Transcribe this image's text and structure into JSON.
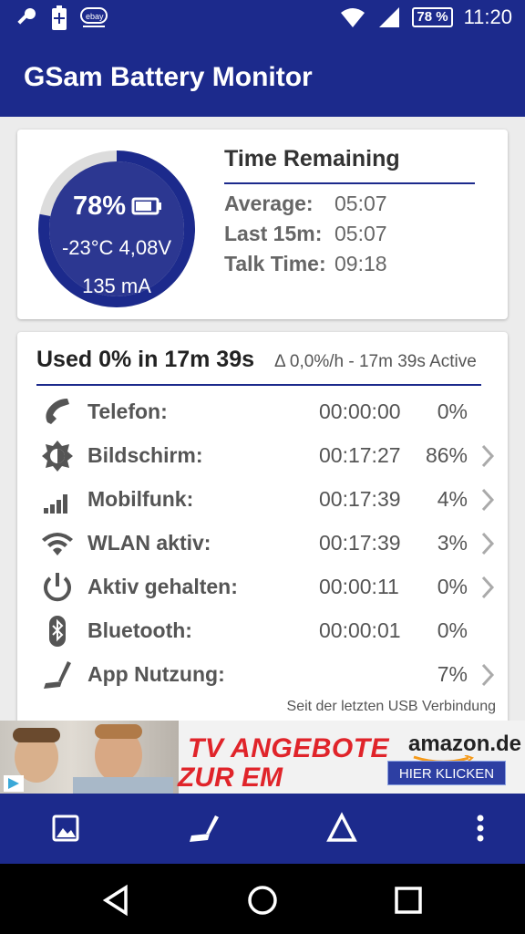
{
  "status_bar": {
    "battery_badge": "78 %",
    "time": "11:20",
    "icons": [
      "key-icon",
      "battery-plus-icon",
      "ebay-icon",
      "wifi-icon",
      "signal-icon"
    ]
  },
  "app": {
    "title": "GSam Battery Monitor"
  },
  "gauge": {
    "percent": "78%",
    "temp_voltage": "-23°C  4,08V",
    "current": "135 mA",
    "fill_fraction": 0.78,
    "colors": {
      "ring": "#1c2a8c",
      "track": "#dcdcdc"
    }
  },
  "time_remaining": {
    "title": "Time Remaining",
    "rows": [
      {
        "label": "Average:",
        "value": "05:07"
      },
      {
        "label": "Last 15m:",
        "value": "05:07"
      },
      {
        "label": "Talk Time:",
        "value": "09:18"
      }
    ]
  },
  "usage": {
    "title": "Used 0% in 17m 39s",
    "subtitle": "Δ 0,0%/h - 17m 39s Active",
    "rows": [
      {
        "name": "Telefon:",
        "time": "00:00:00",
        "pct": "0%",
        "icon": "phone-icon"
      },
      {
        "name": "Bildschirm:",
        "time": "00:17:27",
        "pct": "86%",
        "icon": "brightness-icon"
      },
      {
        "name": "Mobilfunk:",
        "time": "00:17:39",
        "pct": "4%",
        "icon": "cell-signal-icon"
      },
      {
        "name": "WLAN aktiv:",
        "time": "00:17:39",
        "pct": "3%",
        "icon": "wifi-icon"
      },
      {
        "name": "Aktiv gehalten:",
        "time": "00:00:11",
        "pct": "0%",
        "icon": "power-icon"
      },
      {
        "name": "Bluetooth:",
        "time": "00:00:01",
        "pct": "0%",
        "icon": "bluetooth-icon"
      },
      {
        "name": "App Nutzung:",
        "time": "",
        "pct": "7%",
        "icon": "app-usage-icon"
      }
    ],
    "footnote": "Seit der letzten USB Verbindung"
  },
  "ad": {
    "line1": "TV ANGEBOTE",
    "line2": "ZUR EM",
    "brand": "amazon.de",
    "cta": "HIER KLICKEN"
  }
}
